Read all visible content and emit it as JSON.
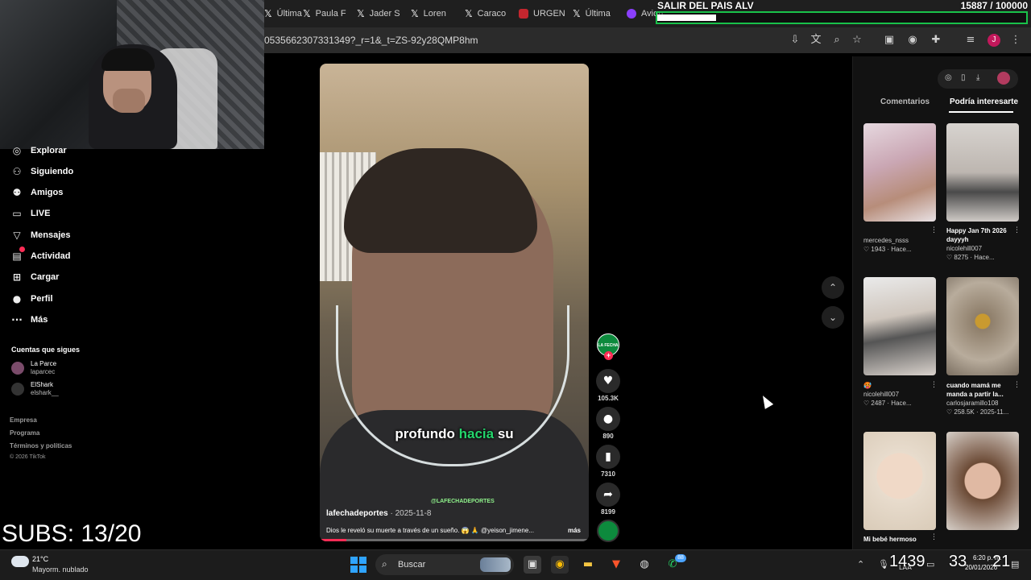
{
  "browser": {
    "tabs": [
      {
        "label": "Última",
        "icon": "x-icon"
      },
      {
        "label": "Paula F",
        "icon": "x-icon"
      },
      {
        "label": "Jader S",
        "icon": "x-icon"
      },
      {
        "label": "Loren",
        "icon": "x-icon"
      },
      {
        "label": "Caraco",
        "icon": "x-icon"
      },
      {
        "label": "URGEN",
        "icon": "red-icon"
      },
      {
        "label": "Última",
        "icon": "x-icon"
      },
      {
        "label": "Avion",
        "icon": "purple-icon"
      }
    ],
    "url": "0535662307331349?_r=1&_t=ZS-92y28QMP8hm"
  },
  "stream_overlay": {
    "goal_title": "SALIR DEL PAIS ALV",
    "goal_current": 15887,
    "goal_target": 100000,
    "goal_count_text": "15887   / 100000",
    "subs_text": "SUBS: 13/20",
    "big_numbers": [
      "1439",
      "33",
      "21"
    ]
  },
  "sidebar": {
    "items": [
      {
        "label": "Explorar",
        "icon": "compass-icon"
      },
      {
        "label": "Siguiendo",
        "icon": "person-icon"
      },
      {
        "label": "Amigos",
        "icon": "friends-icon"
      },
      {
        "label": "LIVE",
        "icon": "live-icon"
      },
      {
        "label": "Mensajes",
        "icon": "send-icon"
      },
      {
        "label": "Actividad",
        "icon": "activity-icon"
      },
      {
        "label": "Cargar",
        "icon": "upload-icon"
      },
      {
        "label": "Perfil",
        "icon": "profile-icon"
      },
      {
        "label": "Más",
        "icon": "more-icon"
      }
    ],
    "following_title": "Cuentas que sigues",
    "following": [
      {
        "name": "La Parce",
        "handle": "laparcec"
      },
      {
        "name": "ElShark",
        "handle": "elshark__"
      }
    ],
    "footer_links": [
      "Empresa",
      "Programa",
      "Términos y políticas"
    ],
    "copyright": "© 2026 TikTok"
  },
  "video": {
    "caption_before": "profundo ",
    "caption_highlight": "hacia",
    "caption_after": " su",
    "watermark": "@LAFECHADEPORTES",
    "author": "lafechadeportes",
    "date": " · 2025-11-8",
    "description": "Dios le reveló su muerte a través de un sueño. 😱 🙏 @yeison_jimene...",
    "more": "más",
    "progress": 0.1,
    "creator_label": "LA FECHA"
  },
  "actions": {
    "likes": "105.3K",
    "comments": "890",
    "saves": "7310",
    "shares": "8199"
  },
  "right_panel": {
    "tab_comments": "Comentarios",
    "tab_related": "Podría interesarte",
    "items": [
      {
        "title": "",
        "user": "mercedes_nsss",
        "meta": "♡ 1943 · Hace..."
      },
      {
        "title": "Happy Jan 7th 2026 dayyyh",
        "user": "nicolehill007",
        "meta": "♡ 8275 · Hace..."
      },
      {
        "title": "🥵",
        "user": "nicolehill007",
        "meta": "♡ 2487 · Hace..."
      },
      {
        "title": "cuando mamá me manda a partir la...",
        "user": "carlosjaramillo108",
        "meta": "♡ 258.5K · 2025-11..."
      },
      {
        "title": "Mi bebé hermoso",
        "user": "",
        "meta": ""
      },
      {
        "title": "",
        "user": "",
        "meta": ""
      }
    ]
  },
  "taskbar": {
    "weather_temp": "21°C",
    "weather_desc": "Mayorm. nublado",
    "search_label": "Buscar",
    "whatsapp_badge": "88",
    "clock_time": "6:20 p. m.",
    "clock_date": "20/01/2026",
    "lang": "LAA"
  }
}
